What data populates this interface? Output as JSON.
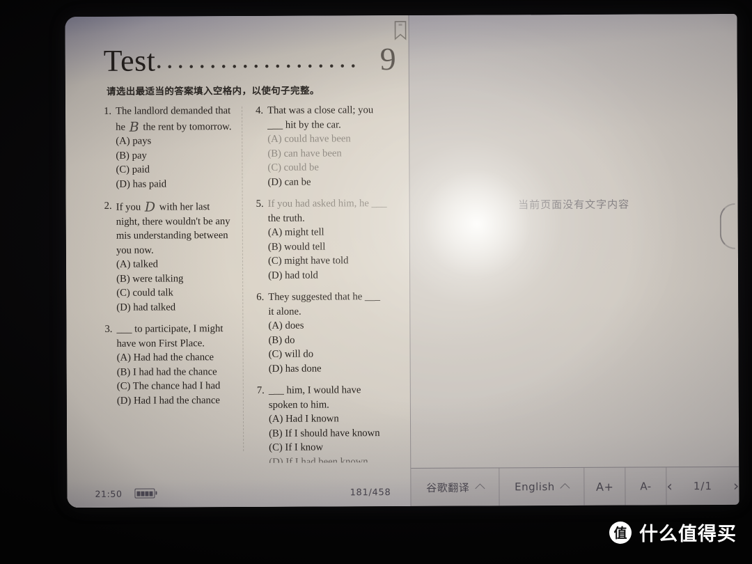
{
  "device": {
    "status_bar": {
      "clock": "21:50",
      "battery_icon": "battery-full-icon",
      "page_indicator": "181/458"
    },
    "bookmark_icon": "bookmark-icon"
  },
  "book": {
    "title_word": "Test",
    "title_dots": "...................",
    "title_number": "9",
    "instruction": "请选出最适当的答案填入空格内，以使句子完整。",
    "columns": [
      {
        "questions": [
          {
            "num": "1.",
            "stem_line1": "The landlord demanded that",
            "stem_line2_pre": "he",
            "handwritten": "B",
            "stem_line2_post": "the rent by tomorrow.",
            "options": [
              "(A) pays",
              "(B) pay",
              "(C) paid",
              "(D) has paid"
            ]
          },
          {
            "num": "2.",
            "stem_line1_pre": "If you",
            "handwritten": "D",
            "stem_line1_post": "with her last",
            "stem_line2": "night, there wouldn't be any",
            "stem_line3": "mis understanding between",
            "stem_line4": "you  now.",
            "options": [
              "(A) talked",
              "(B) were talking",
              "(C) could talk",
              "(D) had talked"
            ]
          },
          {
            "num": "3.",
            "stem_line1": "___ to participate, I might",
            "stem_line2": "have won First Place.",
            "options": [
              "(A) Had had the chance",
              "(B) I had had the chance",
              "(C) The chance had I had",
              "(D) Had I had the chance"
            ]
          }
        ]
      },
      {
        "questions": [
          {
            "num": "4.",
            "stem_line1": "That was a close call; you",
            "stem_line2": "___ hit by the car.",
            "options": [
              "(A) could have been",
              "(B) can have been",
              "(C) could be",
              "(D) can be"
            ]
          },
          {
            "num": "5.",
            "stem_line1": "If you had asked him, he ___",
            "stem_line2": "the truth.",
            "options": [
              "(A) might tell",
              "(B) would tell",
              "(C) might have told",
              "(D) had told"
            ]
          },
          {
            "num": "6.",
            "stem_line1": "They suggested that he ___",
            "stem_line2": "it alone.",
            "options": [
              "(A) does",
              "(B) do",
              "(C) will do",
              "(D) has done"
            ]
          },
          {
            "num": "7.",
            "stem_line1": "___ him, I would have",
            "stem_line2": "spoken to him.",
            "options": [
              "(A) Had I known",
              "(B) If I should have known",
              "(C) If I know",
              "(D) If I had been known"
            ]
          }
        ]
      }
    ]
  },
  "translation_panel": {
    "empty_message": "当前页面没有文字内容",
    "toolbar": {
      "engine_label": "谷歌翻译",
      "engine_chevron_icon": "chevron-up-icon",
      "language_label": "English",
      "language_chevron_icon": "chevron-up-icon",
      "font_increase_label": "A+",
      "font_decrease_label": "A-",
      "prev_icon": "chevron-left-icon",
      "pager_label": "1/1",
      "next_icon": "chevron-right-icon"
    }
  },
  "watermark": {
    "logo_char": "值",
    "text": "什么值得买"
  }
}
